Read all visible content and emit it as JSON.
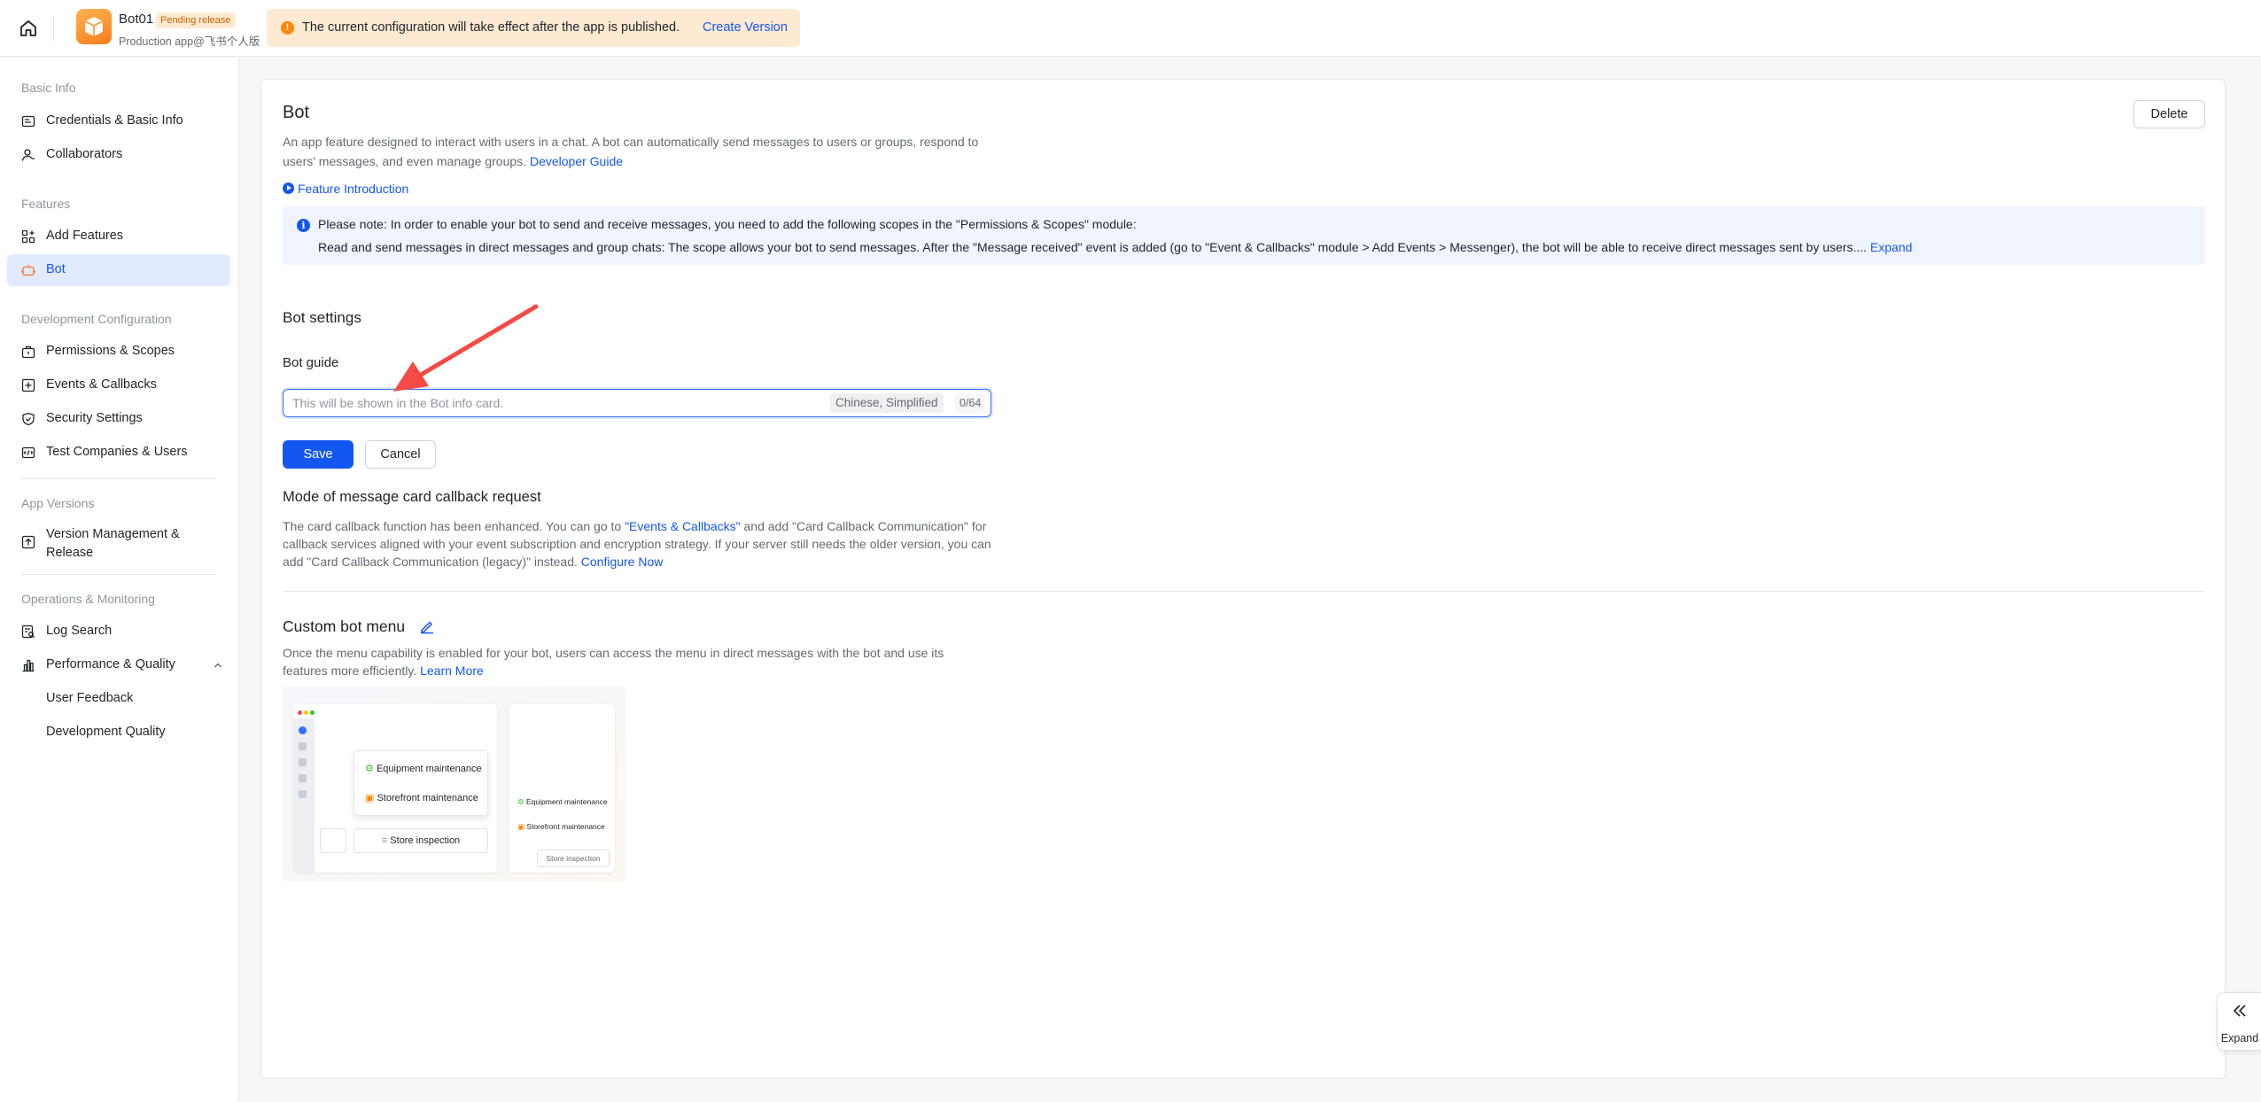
{
  "topbar": {
    "app_name": "Bot01",
    "status_badge": "Pending release",
    "app_subtitle": "Production app@飞书个人版",
    "notice_text": "The current configuration will take effect after the app is published.",
    "notice_link": "Create Version"
  },
  "sidebar": {
    "basic_info": "Basic Info",
    "credentials": "Credentials & Basic Info",
    "collaborators": "Collaborators",
    "features": "Features",
    "add_features": "Add Features",
    "bot": "Bot",
    "dev_config": "Development Configuration",
    "permissions": "Permissions & Scopes",
    "events": "Events & Callbacks",
    "security": "Security Settings",
    "test_companies": "Test Companies & Users",
    "app_versions": "App Versions",
    "version_mgmt": "Version Management & Release",
    "ops": "Operations & Monitoring",
    "log_search": "Log Search",
    "performance": "Performance & Quality",
    "user_feedback": "User Feedback",
    "dev_quality": "Development Quality"
  },
  "main": {
    "title": "Bot",
    "delete_label": "Delete",
    "description": "An app feature designed to interact with users in a chat. A bot can automatically send messages to users or groups, respond to users' messages, and even manage groups.",
    "developer_guide": "Developer Guide",
    "feature_intro": "Feature Introduction",
    "info_line1": "Please note: In order to enable your bot to send and receive messages, you need to add the following scopes in the \"Permissions & Scopes\" module:",
    "info_line2": "Read and send messages in direct messages and group chats: The scope allows your bot to send messages. After the \"Message received\" event is added (go to \"Event & Callbacks\" module > Add Events > Messenger), the bot will be able to receive direct messages sent by users....",
    "info_expand": "Expand",
    "bot_settings": "Bot settings",
    "bot_guide_label": "Bot guide",
    "bot_guide_placeholder": "This will be shown in the Bot info card.",
    "language": "Chinese, Simplified",
    "counter": "0/64",
    "save": "Save",
    "cancel": "Cancel",
    "callback_title": "Mode of message card callback request",
    "callback_desc_1": "The card callback function has been enhanced. You can go to ",
    "callback_link_events": "\"Events & Callbacks\"",
    "callback_desc_2": " and add \"Card Callback Communication\" for callback services aligned with your event subscription and encryption strategy. If your server still needs the older version, you can add \"Card Callback Communication (legacy)\" instead. ",
    "configure_now": "Configure Now",
    "custom_menu_title": "Custom bot menu",
    "custom_menu_desc": "Once the menu capability is enabled for your bot, users can access the menu in direct messages with the bot and use its features more efficiently. ",
    "learn_more": "Learn More"
  },
  "illustration": {
    "item1": "Equipment maintenance",
    "item2": "Storefront maintenance",
    "item3": "Store inspection"
  },
  "expand_label": "Expand",
  "colors": {
    "primary": "#1456f0",
    "warning": "#ff8800",
    "annotation_arrow": "#f54a45"
  }
}
